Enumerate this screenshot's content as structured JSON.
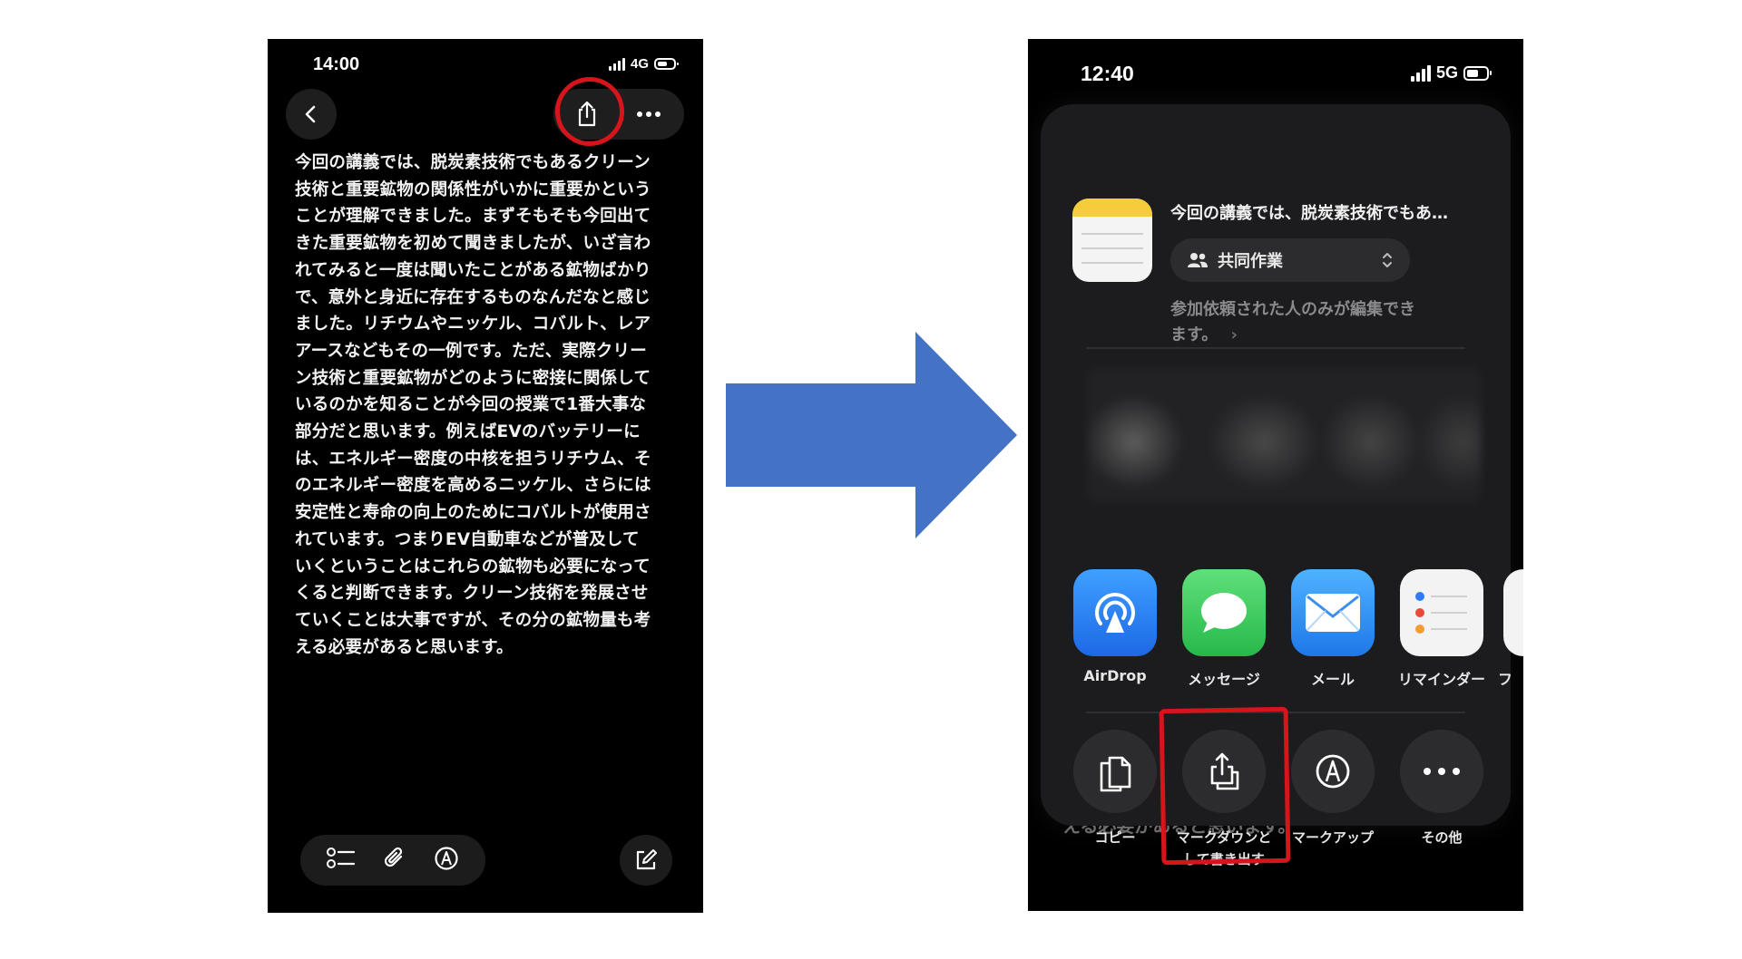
{
  "left_phone": {
    "status": {
      "time": "14:00",
      "network": "4G"
    },
    "note_text": "今回の講義では、脱炭素技術でもあるクリーン\n技術と重要鉱物の関係性がいかに重要かという\nことが理解できました。まずそもそも今回出て\nきた重要鉱物を初めて聞きましたが、いざ言わ\nれてみると一度は聞いたことがある鉱物ばかり\nで、意外と身近に存在するものなんだなと感じ\nました。リチウムやニッケル、コバルト、レア\nアースなどもその一例です。ただ、実際クリー\nン技術と重要鉱物がどのように密接に関係して\nいるのかを知ることが今回の授業で1番大事な\n部分だと思います。例えばEVのバッテリーに\nは、エネルギー密度の中核を担うリチウム、そ\nのエネルギー密度を高めるニッケル、さらには\n安定性と寿命の向上のためにコバルトが使用さ\nれています。つまりEV自動車などが普及して\nいくということはこれらの鉱物も必要になって\nくると判断できます。クリーン技術を発展させ\nていくことは大事ですが、その分の鉱物量も考\nえる必要があると思います。",
    "icons": [
      "back-icon",
      "share-icon",
      "more-icon",
      "checklist-icon",
      "attachment-icon",
      "markup-icon",
      "compose-icon"
    ],
    "annotation_color": "#d6141c"
  },
  "arrow_color": "#4472c4",
  "right_phone": {
    "status": {
      "time": "12:40",
      "network": "5G"
    },
    "share_sheet": {
      "title": "今回の講義では、脱炭素技術でもあ…",
      "collab_option": "共同作業",
      "collab_desc_line1": "参加依頼された人のみが編集でき",
      "collab_desc_line2": "ます。",
      "background_text": "える必要があると思います。",
      "apps": [
        {
          "label": "AirDrop",
          "icon": "airdrop-icon",
          "color": "#2f7df6"
        },
        {
          "label": "メッセージ",
          "icon": "messages-icon",
          "color": "#34c759"
        },
        {
          "label": "メール",
          "icon": "mail-icon",
          "color": "#2d8cf0"
        },
        {
          "label": "リマインダー",
          "icon": "reminders-icon",
          "color": "#f2f2f2"
        },
        {
          "label": "フ"
        }
      ],
      "actions": [
        {
          "label": "コピー",
          "icon": "copy-icon"
        },
        {
          "label_line1": "マークダウンと",
          "label_line2": "して書き出す",
          "icon": "export-icon"
        },
        {
          "label": "マークアップ",
          "icon": "markup-icon"
        },
        {
          "label": "その他",
          "icon": "more-icon"
        }
      ]
    }
  }
}
